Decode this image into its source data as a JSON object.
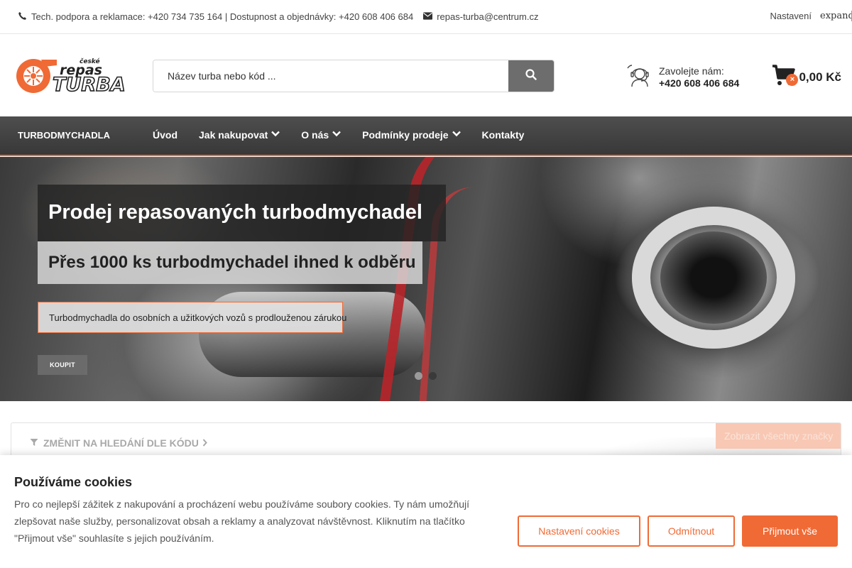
{
  "topbar": {
    "phone_text": "Tech. podpora a reklamace: +420 734 735 164 | Dostupnost a objednávky: +420 608 406 684",
    "email": "repas-turba@centrum.cz",
    "settings_label": "Nastavení",
    "expand_label": "expand_more"
  },
  "header": {
    "logo_small": "české",
    "logo_word1": "repas",
    "logo_word2": "TURBA",
    "search_placeholder": "Název turba nebo kód ...",
    "call_label": "Zavolejte nám:",
    "call_number": "+420 608 406 684",
    "cart_price": "0,00 Kč",
    "cart_badge": "×"
  },
  "nav": {
    "category": "TURBODMYCHADLA ",
    "items": [
      {
        "label": "Úvod",
        "dropdown": false
      },
      {
        "label": "Jak nakupovat",
        "dropdown": true
      },
      {
        "label": "O nás",
        "dropdown": true
      },
      {
        "label": "Podmínky prodeje",
        "dropdown": true
      },
      {
        "label": "Kontakty",
        "dropdown": false
      }
    ]
  },
  "hero": {
    "title": "Prodej repasovaných turbodmychadel",
    "subtitle": "Přes 1000 ks turbodmychadel ihned k odběru",
    "text": "Turbodmychadla do osobních a užitkových vozů s prodlouženou zárukou",
    "button": "KOUPIT",
    "dots": [
      {
        "active": true
      },
      {
        "active": false
      }
    ]
  },
  "finder": {
    "switch_label": "ZMĚNIT NA HLEDÁNÍ DLE KÓDU",
    "all_brands_label": "Zobrazit všechny značky"
  },
  "cookie": {
    "title": "Používáme cookies",
    "text": "Pro co nejlepší zážitek z nakupování a procházení webu používáme soubory cookies. Ty nám umožňují zlepšovat naše služby, personalizovat obsah a reklamy a analyzovat návštěvnost. Kliknutím na tlačítko \"Přijmout vše\" souhlasíte s jejich používáním.",
    "settings_btn": "Nastavení cookies",
    "reject_btn": "Odmítnout",
    "accept_btn": "Přijmout vše"
  },
  "colors": {
    "accent": "#f06a35",
    "nav_bg": "#444444",
    "dot_active": "#9a9a9a",
    "dot_inactive": "#3a3a3a"
  }
}
